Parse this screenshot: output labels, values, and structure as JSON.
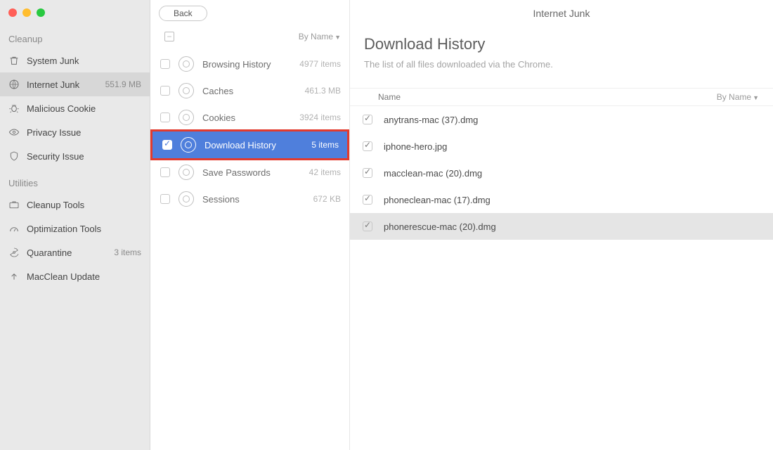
{
  "window_title": "Internet Junk",
  "back_label": "Back",
  "byname_label": "By Name",
  "sidebar": {
    "sections": [
      {
        "title": "Cleanup",
        "items": [
          {
            "label": "System Junk",
            "meta": "",
            "icon": "trash-icon",
            "active": false
          },
          {
            "label": "Internet Junk",
            "meta": "551.9 MB",
            "icon": "globe-icon",
            "active": true
          },
          {
            "label": "Malicious Cookie",
            "meta": "",
            "icon": "bug-icon",
            "active": false
          },
          {
            "label": "Privacy Issue",
            "meta": "",
            "icon": "eye-icon",
            "active": false
          },
          {
            "label": "Security Issue",
            "meta": "",
            "icon": "shield-icon",
            "active": false
          }
        ]
      },
      {
        "title": "Utilities",
        "items": [
          {
            "label": "Cleanup Tools",
            "meta": "",
            "icon": "toolbox-icon",
            "active": false
          },
          {
            "label": "Optimization Tools",
            "meta": "",
            "icon": "gauge-icon",
            "active": false
          },
          {
            "label": "Quarantine",
            "meta": "3 items",
            "icon": "radiation-icon",
            "active": false
          },
          {
            "label": "MacClean Update",
            "meta": "",
            "icon": "upload-icon",
            "active": false
          }
        ]
      }
    ]
  },
  "categories": [
    {
      "label": "Browsing History",
      "meta": "4977 items",
      "active": false
    },
    {
      "label": "Caches",
      "meta": "461.3 MB",
      "active": false
    },
    {
      "label": "Cookies",
      "meta": "3924 items",
      "active": false
    },
    {
      "label": "Download History",
      "meta": "5 items",
      "active": true
    },
    {
      "label": "Save Passwords",
      "meta": "42 items",
      "active": false
    },
    {
      "label": "Sessions",
      "meta": "672 KB",
      "active": false
    }
  ],
  "detail": {
    "title": "Download History",
    "subtitle": "The list of all files downloaded via the Chrome.",
    "table_header": "Name",
    "files": [
      {
        "name": "anytrans-mac (37).dmg",
        "checked": true,
        "selected": false
      },
      {
        "name": "iphone-hero.jpg",
        "checked": true,
        "selected": false
      },
      {
        "name": "macclean-mac (20).dmg",
        "checked": true,
        "selected": false
      },
      {
        "name": "phoneclean-mac (17).dmg",
        "checked": true,
        "selected": false
      },
      {
        "name": "phonerescue-mac (20).dmg",
        "checked": true,
        "selected": true
      }
    ]
  }
}
